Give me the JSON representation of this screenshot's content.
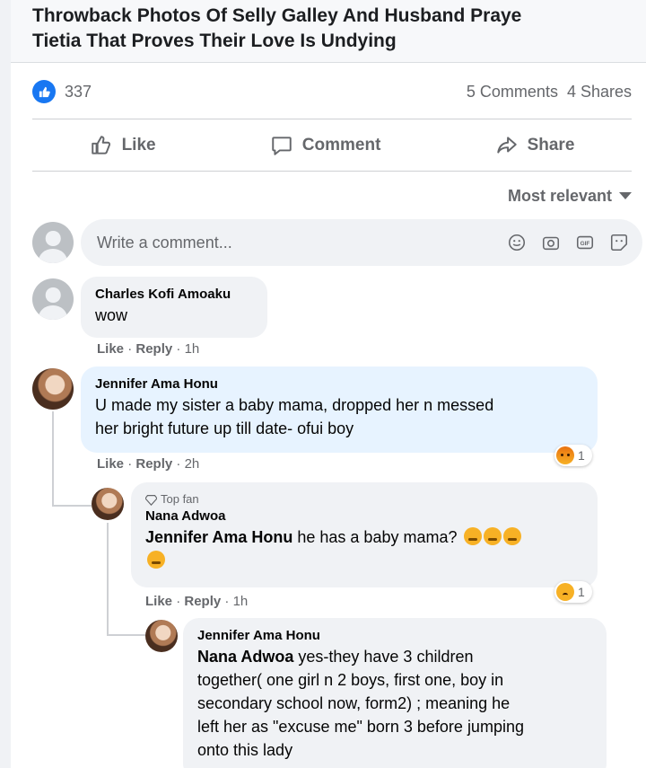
{
  "post": {
    "title_line1": "Throwback Photos Of Selly Galley And Husband Praye",
    "title_line2": "Tietia That Proves Their Love Is Undying"
  },
  "stats": {
    "likes": "337",
    "comments": "5 Comments",
    "shares": "4 Shares"
  },
  "actions": {
    "like": "Like",
    "comment": "Comment",
    "share": "Share"
  },
  "sort": {
    "label": "Most relevant"
  },
  "composer": {
    "placeholder": "Write a comment..."
  },
  "comments": [
    {
      "author": "Charles Kofi Amoaku",
      "text": "wow",
      "like": "Like",
      "reply": "Reply",
      "time": "1h"
    },
    {
      "author": "Jennifer Ama Honu",
      "text_line1": "U made my sister a baby mama, dropped her n messed",
      "text_line2": "her bright future up till date- ofui boy",
      "like": "Like",
      "reply": "Reply",
      "time": "2h",
      "reaction_count": "1",
      "reaction": "angry",
      "replies": [
        {
          "badge": "Top fan",
          "author": "Nana Adwoa",
          "mention": "Jennifer Ama Honu",
          "text": "he has a baby mama?",
          "like": "Like",
          "reply": "Reply",
          "time": "1h",
          "reaction_count": "1",
          "reaction": "sad"
        },
        {
          "author": "Jennifer Ama Honu",
          "mention": "Nana Adwoa",
          "text_line1": "yes-they have 3 children",
          "text_line2": "together( one girl n 2 boys, first one, boy in",
          "text_line3": "secondary school now, form2) ; meaning he",
          "text_line4": "left her as \"excuse me\" born 3 before jumping",
          "text_line5": "onto this lady"
        }
      ]
    }
  ],
  "colors": {
    "accent": "#1877f2",
    "muted": "#65676b",
    "bubble": "#f0f2f5",
    "highlight": "#e7f3ff"
  }
}
